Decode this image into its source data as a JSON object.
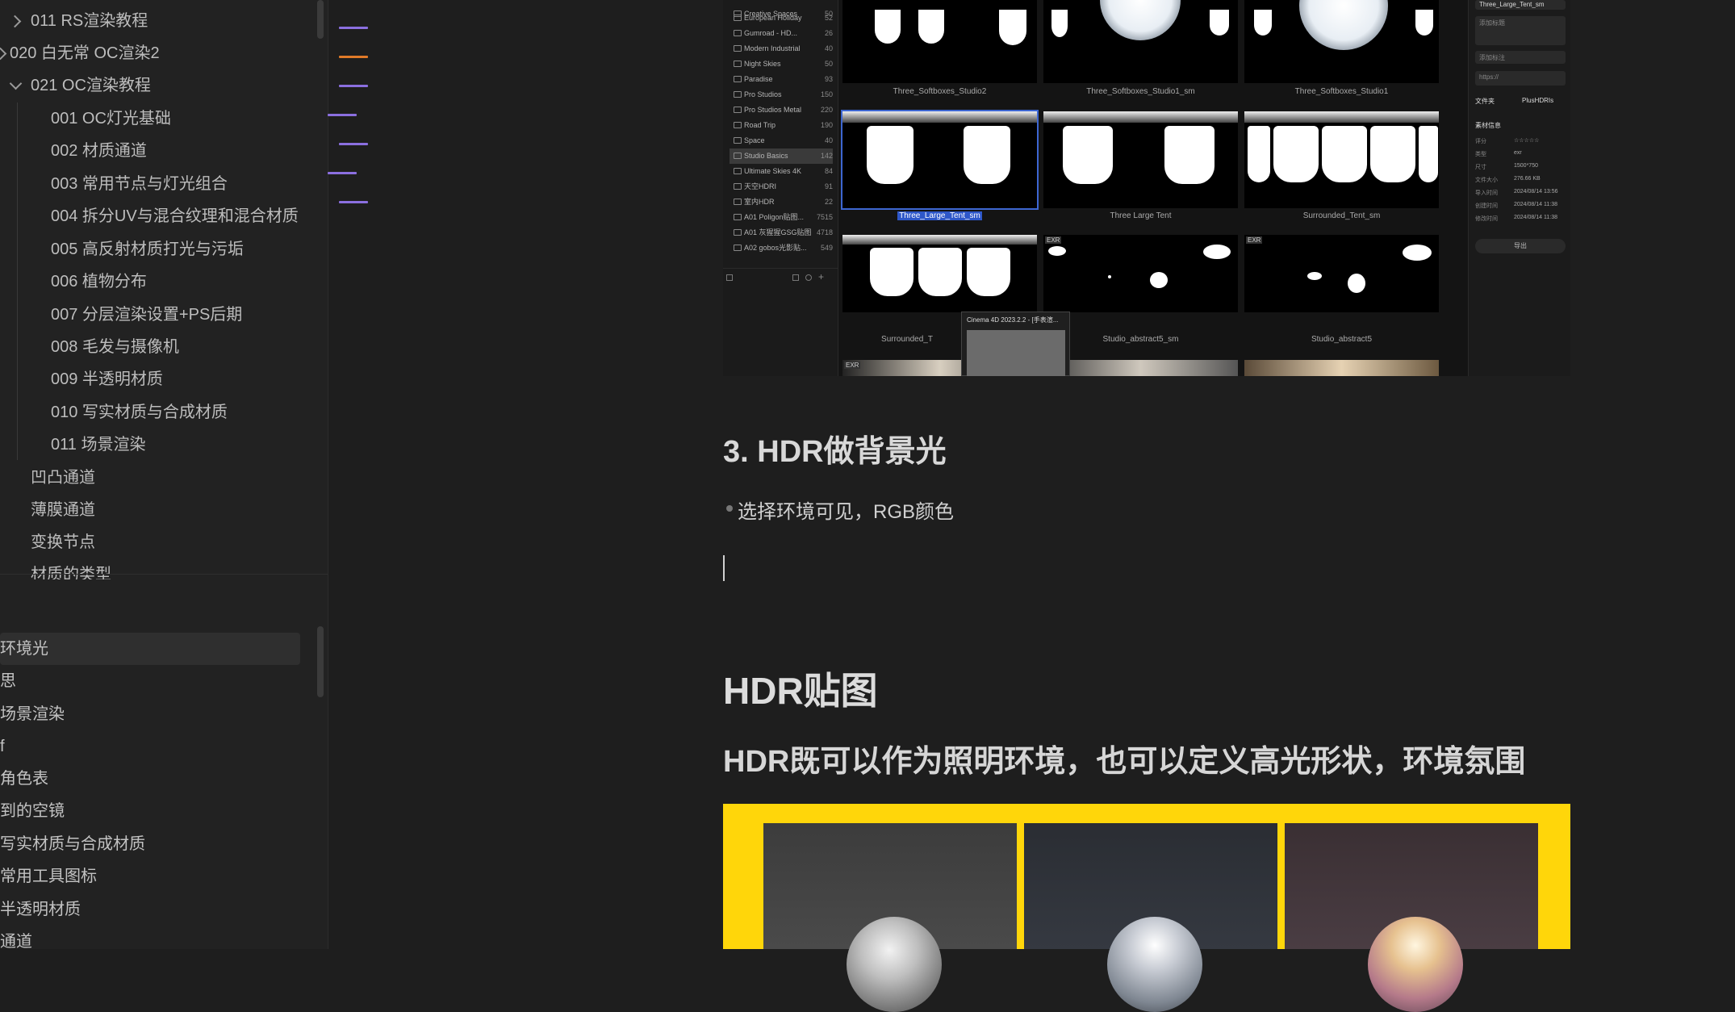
{
  "sidebar": {
    "tree": [
      {
        "label": "011  RS渲染教程",
        "expanded": false
      },
      {
        "label": "020 白无常 OC渲染2",
        "expanded": false
      },
      {
        "label": "021 OC渲染教程",
        "expanded": true
      },
      {
        "label": "001 OC灯光基础"
      },
      {
        "label": "002 材质通道"
      },
      {
        "label": "003 常用节点与灯光组合"
      },
      {
        "label": "004 拆分UV与混合纹理和混合材质"
      },
      {
        "label": "005 高反射材质打光与污垢"
      },
      {
        "label": "006 植物分布"
      },
      {
        "label": "007 分层渲染设置+PS后期"
      },
      {
        "label": "008 毛发与摄像机"
      },
      {
        "label": "009 半透明材质"
      },
      {
        "label": "010 写实材质与合成材质"
      },
      {
        "label": "011 场景渲染"
      },
      {
        "label": "凹凸通道"
      },
      {
        "label": "薄膜通道"
      },
      {
        "label": "变换节点"
      },
      {
        "label": "材质的类型"
      }
    ],
    "outline": [
      {
        "label": "环境光",
        "active": true
      },
      {
        "label": "思"
      },
      {
        "label": "场景渲染"
      },
      {
        "label": "f"
      },
      {
        "label": "角色表"
      },
      {
        "label": "到的空镜"
      },
      {
        "label": "写实材质与合成材质"
      },
      {
        "label": "常用工具图标"
      },
      {
        "label": "半透明材质"
      },
      {
        "label": "通道"
      }
    ],
    "outline_marks": [
      {
        "color": "#8b6fe0"
      },
      {
        "color": "#e07a28"
      },
      {
        "color": "#8b6fe0"
      },
      {
        "color": "#8b6fe0"
      },
      {
        "color": "#8b6fe0"
      },
      {
        "color": "#8b6fe0"
      },
      {
        "color": "#8b6fe0"
      }
    ]
  },
  "screenshot": {
    "folders": [
      {
        "name": "Creative Spaces",
        "count": "50"
      },
      {
        "name": "European Holiday",
        "count": "52"
      },
      {
        "name": "Gumroad - HD...",
        "count": "26"
      },
      {
        "name": "Modern Industrial",
        "count": "40"
      },
      {
        "name": "Night Skies",
        "count": "50"
      },
      {
        "name": "Paradise",
        "count": "93"
      },
      {
        "name": "Pro Studios",
        "count": "150"
      },
      {
        "name": "Pro Studios Metal",
        "count": "220"
      },
      {
        "name": "Road Trip",
        "count": "190"
      },
      {
        "name": "Space",
        "count": "40"
      },
      {
        "name": "Studio Basics",
        "count": "142",
        "selected": true
      },
      {
        "name": "Ultimate Skies 4K",
        "count": "84"
      },
      {
        "name": "天空HDRI",
        "count": "91"
      },
      {
        "name": "室内HDR",
        "count": "22"
      },
      {
        "name": "A01 Poligon贴图...",
        "count": "7515"
      },
      {
        "name": "A01 灰猩猩GSG贴图",
        "count": "4718"
      },
      {
        "name": "A02 gobos光影贴...",
        "count": "549"
      }
    ],
    "captions": {
      "row1": [
        "Three_Softboxes_Studio2",
        "Three_Softboxes_Studio1_sm",
        "Three_Softboxes_Studio1"
      ],
      "row2": [
        "Three_Large_Tent_sm",
        "Three Large Tent",
        "Surrounded_Tent_sm"
      ],
      "row3": [
        "Surrounded_T",
        "Studio_abstract5_sm",
        "Studio_abstract5"
      ]
    },
    "exr_badge": "EXR",
    "right_panel": {
      "filename": "Three_Large_Tent_sm",
      "title_placeholder": "添加标题",
      "tag_placeholder": "添加标注",
      "url_placeholder": "https://",
      "folder_label": "文件夹",
      "folder_value": "PlusHDRIs",
      "info_title": "素材信息",
      "rows": [
        {
          "k": "评分",
          "v": "☆☆☆☆☆"
        },
        {
          "k": "类型",
          "v": "exr"
        },
        {
          "k": "尺寸",
          "v": "1500*750"
        },
        {
          "k": "文件大小",
          "v": "276.66 KB"
        },
        {
          "k": "导入时间",
          "v": "2024/08/14 13:56"
        },
        {
          "k": "创建时间",
          "v": "2024/08/14 11:38"
        },
        {
          "k": "修改时间",
          "v": "2024/08/14 11:38"
        }
      ],
      "export_label": "导出"
    },
    "popup_title": "Cinema 4D 2023.2.2 - [手表渲..."
  },
  "doc": {
    "h3": "3. HDR做背景光",
    "bullet": "选择环境可见，RGB颜色",
    "h1": "HDR贴图",
    "h2": "HDR既可以作为照明环境，也可以定义高光形状，环境氛围"
  },
  "colors": {
    "accent_purple": "#8b6fe0",
    "accent_orange": "#e07a28",
    "yellow": "#ffd60a",
    "selection_blue": "#2e57c9"
  }
}
